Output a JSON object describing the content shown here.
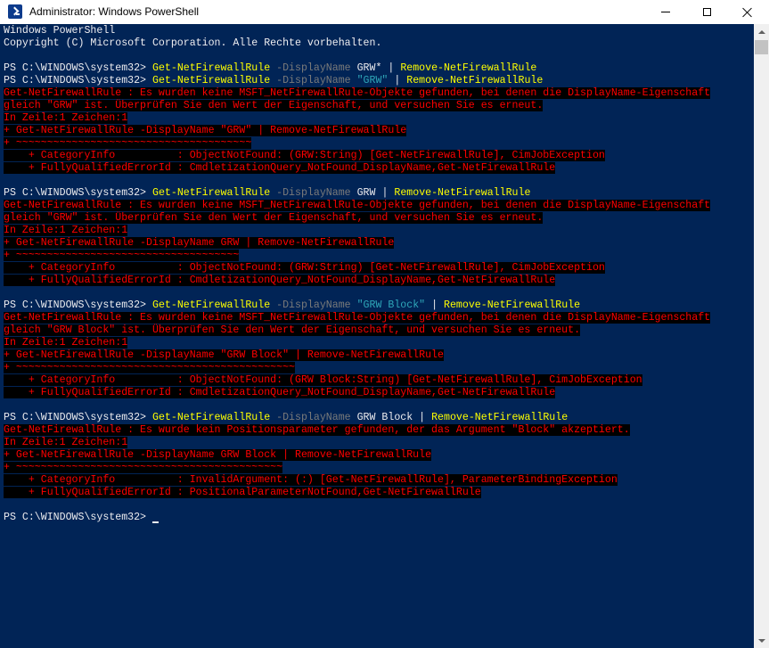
{
  "window": {
    "title": "Administrator: Windows PowerShell",
    "icon": "powershell-icon",
    "controls": [
      "minimize-icon",
      "maximize-icon",
      "close-icon"
    ]
  },
  "colors": {
    "console_bg": "#012456",
    "text_default": "#eeedf0",
    "text_command": "#ffff00",
    "text_parameter": "#7a7a7a",
    "text_string": "#2fa7b9",
    "text_error": "#ff0000",
    "error_bg": "#000000"
  },
  "console": {
    "lines": [
      [
        {
          "t": "Windows PowerShell",
          "c": "w"
        }
      ],
      [
        {
          "t": "Copyright (C) Microsoft Corporation. Alle Rechte vorbehalten.",
          "c": "w"
        }
      ],
      [],
      [
        {
          "t": "PS C:\\WINDOWS\\system32> ",
          "c": "w"
        },
        {
          "t": "Get-NetFirewallRule",
          "c": "y"
        },
        {
          "t": " -DisplayName",
          "c": "g"
        },
        {
          "t": " GRW*",
          "c": "w"
        },
        {
          "t": " | ",
          "c": "w"
        },
        {
          "t": "Remove-NetFirewallRule",
          "c": "y"
        }
      ],
      [
        {
          "t": "PS C:\\WINDOWS\\system32> ",
          "c": "w"
        },
        {
          "t": "Get-NetFirewallRule",
          "c": "y"
        },
        {
          "t": " -DisplayName",
          "c": "g"
        },
        {
          "t": " \"GRW\"",
          "c": "c"
        },
        {
          "t": " | ",
          "c": "w"
        },
        {
          "t": "Remove-NetFirewallRule",
          "c": "y"
        }
      ],
      [
        {
          "t": "Get-NetFirewallRule : Es wurden keine MSFT_NetFirewallRule-Objekte gefunden, bei denen die DisplayName-Eigenschaft",
          "c": "r"
        }
      ],
      [
        {
          "t": "gleich \"GRW\" ist. Überprüfen Sie den Wert der Eigenschaft, und versuchen Sie es erneut.",
          "c": "r"
        }
      ],
      [
        {
          "t": "In Zeile:1 Zeichen:1",
          "c": "r"
        }
      ],
      [
        {
          "t": "+ Get-NetFirewallRule -DisplayName \"GRW\" | Remove-NetFirewallRule",
          "c": "r"
        }
      ],
      [
        {
          "t": "+ ~~~~~~~~~~~~~~~~~~~~~~~~~~~~~~~~~~~~~~",
          "c": "r"
        }
      ],
      [
        {
          "t": "    + CategoryInfo          : ObjectNotFound: (GRW:String) [Get-NetFirewallRule], CimJobException",
          "c": "r"
        }
      ],
      [
        {
          "t": "    + FullyQualifiedErrorId : CmdletizationQuery_NotFound_DisplayName,Get-NetFirewallRule",
          "c": "r"
        }
      ],
      [],
      [
        {
          "t": "PS C:\\WINDOWS\\system32> ",
          "c": "w"
        },
        {
          "t": "Get-NetFirewallRule",
          "c": "y"
        },
        {
          "t": " -DisplayName",
          "c": "g"
        },
        {
          "t": " GRW",
          "c": "w"
        },
        {
          "t": " | ",
          "c": "w"
        },
        {
          "t": "Remove-NetFirewallRule",
          "c": "y"
        }
      ],
      [
        {
          "t": "Get-NetFirewallRule : Es wurden keine MSFT_NetFirewallRule-Objekte gefunden, bei denen die DisplayName-Eigenschaft",
          "c": "r"
        }
      ],
      [
        {
          "t": "gleich \"GRW\" ist. Überprüfen Sie den Wert der Eigenschaft, und versuchen Sie es erneut.",
          "c": "r"
        }
      ],
      [
        {
          "t": "In Zeile:1 Zeichen:1",
          "c": "r"
        }
      ],
      [
        {
          "t": "+ Get-NetFirewallRule -DisplayName GRW | Remove-NetFirewallRule",
          "c": "r"
        }
      ],
      [
        {
          "t": "+ ~~~~~~~~~~~~~~~~~~~~~~~~~~~~~~~~~~~~",
          "c": "r"
        }
      ],
      [
        {
          "t": "    + CategoryInfo          : ObjectNotFound: (GRW:String) [Get-NetFirewallRule], CimJobException",
          "c": "r"
        }
      ],
      [
        {
          "t": "    + FullyQualifiedErrorId : CmdletizationQuery_NotFound_DisplayName,Get-NetFirewallRule",
          "c": "r"
        }
      ],
      [],
      [
        {
          "t": "PS C:\\WINDOWS\\system32> ",
          "c": "w"
        },
        {
          "t": "Get-NetFirewallRule",
          "c": "y"
        },
        {
          "t": " -DisplayName",
          "c": "g"
        },
        {
          "t": " \"GRW Block\"",
          "c": "c"
        },
        {
          "t": " | ",
          "c": "w"
        },
        {
          "t": "Remove-NetFirewallRule",
          "c": "y"
        }
      ],
      [
        {
          "t": "Get-NetFirewallRule : Es wurden keine MSFT_NetFirewallRule-Objekte gefunden, bei denen die DisplayName-Eigenschaft",
          "c": "r"
        }
      ],
      [
        {
          "t": "gleich \"GRW Block\" ist. Überprüfen Sie den Wert der Eigenschaft, und versuchen Sie es erneut.",
          "c": "r"
        }
      ],
      [
        {
          "t": "In Zeile:1 Zeichen:1",
          "c": "r"
        }
      ],
      [
        {
          "t": "+ Get-NetFirewallRule -DisplayName \"GRW Block\" | Remove-NetFirewallRule",
          "c": "r"
        }
      ],
      [
        {
          "t": "+ ~~~~~~~~~~~~~~~~~~~~~~~~~~~~~~~~~~~~~~~~~~~~~",
          "c": "r"
        }
      ],
      [
        {
          "t": "    + CategoryInfo          : ObjectNotFound: (GRW Block:String) [Get-NetFirewallRule], CimJobException",
          "c": "r"
        }
      ],
      [
        {
          "t": "    + FullyQualifiedErrorId : CmdletizationQuery_NotFound_DisplayName,Get-NetFirewallRule",
          "c": "r"
        }
      ],
      [],
      [
        {
          "t": "PS C:\\WINDOWS\\system32> ",
          "c": "w"
        },
        {
          "t": "Get-NetFirewallRule",
          "c": "y"
        },
        {
          "t": " -DisplayName",
          "c": "g"
        },
        {
          "t": " GRW Block",
          "c": "w"
        },
        {
          "t": " | ",
          "c": "w"
        },
        {
          "t": "Remove-NetFirewallRule",
          "c": "y"
        }
      ],
      [
        {
          "t": "Get-NetFirewallRule : Es wurde kein Positionsparameter gefunden, der das Argument \"Block\" akzeptiert.",
          "c": "r"
        }
      ],
      [
        {
          "t": "In Zeile:1 Zeichen:1",
          "c": "r"
        }
      ],
      [
        {
          "t": "+ Get-NetFirewallRule -DisplayName GRW Block | Remove-NetFirewallRule",
          "c": "r"
        }
      ],
      [
        {
          "t": "+ ~~~~~~~~~~~~~~~~~~~~~~~~~~~~~~~~~~~~~~~~~~~",
          "c": "r"
        }
      ],
      [
        {
          "t": "    + CategoryInfo          : InvalidArgument: (:) [Get-NetFirewallRule], ParameterBindingException",
          "c": "r"
        }
      ],
      [
        {
          "t": "    + FullyQualifiedErrorId : PositionalParameterNotFound,Get-NetFirewallRule",
          "c": "r"
        }
      ],
      [],
      [
        {
          "t": "PS C:\\WINDOWS\\system32>",
          "c": "w"
        }
      ]
    ]
  }
}
